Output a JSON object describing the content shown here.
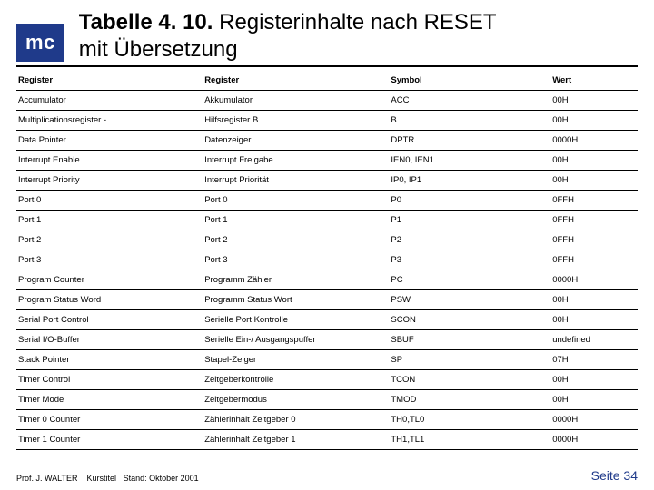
{
  "badge": "mc",
  "title_strong": "Tabelle 4. 10. ",
  "title_rest": "Registerinhalte nach RESET\nmit Übersetzung",
  "columns": [
    "Register",
    "Register",
    "Symbol",
    "Wert"
  ],
  "rows": [
    [
      "Accumulator",
      "Akkumulator",
      "ACC",
      "00H"
    ],
    [
      "Multiplicationsregister -",
      "Hilfsregister B",
      "B",
      "00H"
    ],
    [
      "Data Pointer",
      "Datenzeiger",
      "DPTR",
      "0000H"
    ],
    [
      "Interrupt Enable",
      "Interrupt Freigabe",
      "IEN0, IEN1",
      "00H"
    ],
    [
      "Interrupt Priority",
      "Interrupt Priorität",
      "IP0, IP1",
      "00H"
    ],
    [
      "Port 0",
      "Port 0",
      "P0",
      "0FFH"
    ],
    [
      "Port 1",
      "Port 1",
      "P1",
      "0FFH"
    ],
    [
      "Port 2",
      "Port 2",
      "P2",
      "0FFH"
    ],
    [
      "Port 3",
      "Port 3",
      "P3",
      "0FFH"
    ],
    [
      "Program Counter",
      "Programm Zähler",
      "PC",
      "0000H"
    ],
    [
      "Program Status Word",
      "Programm Status Wort",
      "PSW",
      "00H"
    ],
    [
      "Serial Port Control",
      "Serielle Port Kontrolle",
      "SCON",
      "00H"
    ],
    [
      "Serial I/O-Buffer",
      "Serielle Ein-/ Ausgangspuffer",
      "SBUF",
      "undefined"
    ],
    [
      "Stack Pointer",
      "Stapel-Zeiger",
      "SP",
      "07H"
    ],
    [
      "Timer Control",
      "Zeitgeberkontrolle",
      "TCON",
      "00H"
    ],
    [
      "Timer Mode",
      "Zeitgebermodus",
      "TMOD",
      "00H"
    ],
    [
      "Timer 0 Counter",
      "Zählerinhalt Zeitgeber 0",
      "TH0,TL0",
      "0000H"
    ],
    [
      "Timer 1 Counter",
      "Zählerinhalt Zeitgeber 1",
      "TH1,TL1",
      "0000H"
    ]
  ],
  "footer_author": "Prof. J. WALTER",
  "footer_course": "Kurstitel",
  "footer_date": "Stand: Oktober 2001",
  "footer_page": "Seite 34",
  "chart_data": {
    "type": "table",
    "title": "Tabelle 4. 10. Registerinhalte nach RESET mit Übersetzung",
    "columns": [
      "Register",
      "Register",
      "Symbol",
      "Wert"
    ],
    "rows": [
      [
        "Accumulator",
        "Akkumulator",
        "ACC",
        "00H"
      ],
      [
        "Multiplicationsregister -",
        "Hilfsregister B",
        "B",
        "00H"
      ],
      [
        "Data Pointer",
        "Datenzeiger",
        "DPTR",
        "0000H"
      ],
      [
        "Interrupt Enable",
        "Interrupt Freigabe",
        "IEN0, IEN1",
        "00H"
      ],
      [
        "Interrupt Priority",
        "Interrupt Priorität",
        "IP0, IP1",
        "00H"
      ],
      [
        "Port 0",
        "Port 0",
        "P0",
        "0FFH"
      ],
      [
        "Port 1",
        "Port 1",
        "P1",
        "0FFH"
      ],
      [
        "Port 2",
        "Port 2",
        "P2",
        "0FFH"
      ],
      [
        "Port 3",
        "Port 3",
        "P3",
        "0FFH"
      ],
      [
        "Program Counter",
        "Programm Zähler",
        "PC",
        "0000H"
      ],
      [
        "Program Status Word",
        "Programm Status Wort",
        "PSW",
        "00H"
      ],
      [
        "Serial Port Control",
        "Serielle Port Kontrolle",
        "SCON",
        "00H"
      ],
      [
        "Serial I/O-Buffer",
        "Serielle Ein-/ Ausgangspuffer",
        "SBUF",
        "undefined"
      ],
      [
        "Stack Pointer",
        "Stapel-Zeiger",
        "SP",
        "07H"
      ],
      [
        "Timer Control",
        "Zeitgeberkontrolle",
        "TCON",
        "00H"
      ],
      [
        "Timer Mode",
        "Zeitgebermodus",
        "TMOD",
        "00H"
      ],
      [
        "Timer 0 Counter",
        "Zählerinhalt Zeitgeber 0",
        "TH0,TL0",
        "0000H"
      ],
      [
        "Timer 1 Counter",
        "Zählerinhalt Zeitgeber 1",
        "TH1,TL1",
        "0000H"
      ]
    ]
  }
}
